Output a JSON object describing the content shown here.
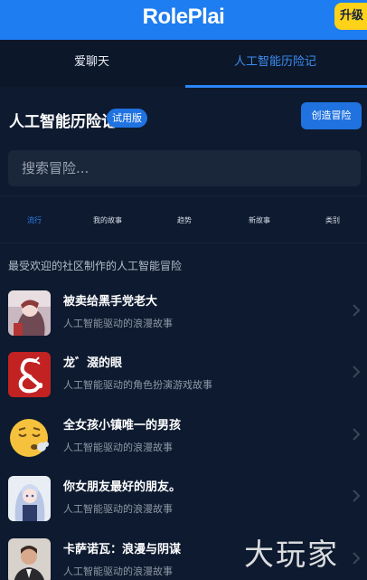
{
  "app": {
    "title": "RolePlai",
    "upgrade_label": "升级"
  },
  "tabs": [
    {
      "label": "爱聊天",
      "active": false
    },
    {
      "label": "人工智能历险记",
      "active": true
    }
  ],
  "section": {
    "title": "人工智能历险记",
    "badge": "试用版",
    "create_button": "创造冒险"
  },
  "search": {
    "placeholder": "搜索冒险..."
  },
  "filters": [
    {
      "label": "流行",
      "active": true
    },
    {
      "label": "我的故事",
      "active": false
    },
    {
      "label": "趋势",
      "active": false
    },
    {
      "label": "新故事",
      "active": false
    },
    {
      "label": "类别",
      "active": false
    }
  ],
  "popular_heading": "最受欢迎的社区制作的人工智能冒险",
  "stories": [
    {
      "title": "被卖给黑手党老大",
      "description": "人工智能驱动的浪漫故事",
      "thumb": "anime-character-icon"
    },
    {
      "title": "龙゛涰的眼",
      "description": "人工智能驱动的角色扮演游戏故事",
      "thumb": "dnd-ampersand-logo"
    },
    {
      "title": "全女孩小镇唯一的男孩",
      "description": "人工智能驱动的浪漫故事",
      "thumb": "sleepy-face-emoji"
    },
    {
      "title": "你女朋友最好的朋友。",
      "description": "人工智能驱动的浪漫故事",
      "thumb": "anime-girl-icon"
    },
    {
      "title": "卡萨诺瓦：浪漫与阴谋",
      "description": "人工智能驱动的浪漫故事",
      "thumb": "man-portrait-icon"
    }
  ],
  "watermark": "大玩家",
  "colors": {
    "accent": "#1e7df0",
    "upgrade": "#ffd21a",
    "background": "#0d1a2f"
  }
}
